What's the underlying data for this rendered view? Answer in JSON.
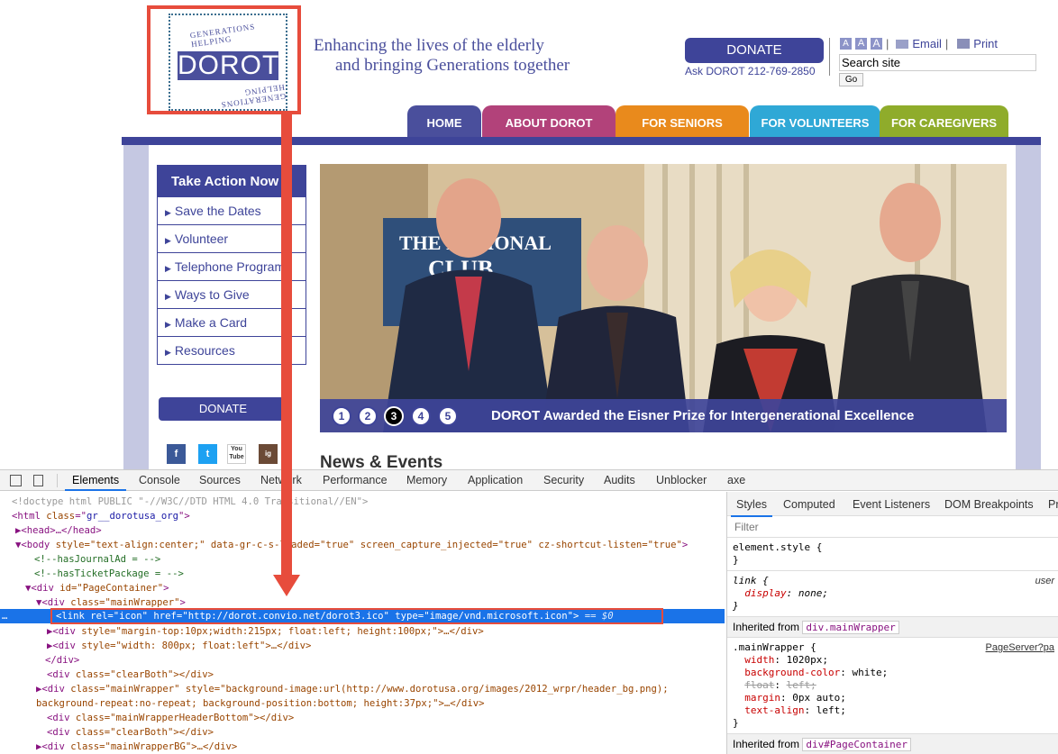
{
  "site": {
    "logo": {
      "arc_top": "GENERATIONS HELPING",
      "word": "DOROT",
      "arc_bottom": "GENERATIONS HELPING"
    },
    "tagline_line1": "Enhancing the lives of the elderly",
    "tagline_line2": "and bringing Generations together",
    "donate_top": "DONATE",
    "ask": "Ask DOROT 212-769-2850",
    "text_size": [
      "A",
      "A",
      "A"
    ],
    "email": "Email",
    "print": "Print",
    "search_value": "Search site",
    "go": "Go",
    "nav": [
      "HOME",
      "ABOUT DOROT",
      "FOR SENIORS",
      "FOR VOLUNTEERS",
      "FOR CAREGIVERS"
    ],
    "nav_colors": [
      "#4a4f9c",
      "#b2427a",
      "#e98a1c",
      "#2fa8d6",
      "#8fac2b"
    ],
    "take_action": "Take Action Now",
    "side_items": [
      "Save the Dates",
      "Volunteer",
      "Telephone Programs",
      "Ways to Give",
      "Make a Card",
      "Resources"
    ],
    "donate_side": "DONATE",
    "social": [
      "f",
      "t",
      "You Tube",
      "ig"
    ],
    "slider_dots": [
      "1",
      "2",
      "3",
      "4",
      "5"
    ],
    "active_dot": "3",
    "hero_caption": "DOROT Awarded the Eisner Prize for Intergenerational Excellence",
    "hero_sign": "THE NATIONAL PRESS CLUB WHERE NEWS HAPPENS",
    "news_heading": "News & Events"
  },
  "devtools": {
    "tabs": [
      "Elements",
      "Console",
      "Sources",
      "Network",
      "Performance",
      "Memory",
      "Application",
      "Security",
      "Audits",
      "Unblocker",
      "axe"
    ],
    "active_tab": "Elements",
    "dom": {
      "doctype": "<!doctype html PUBLIC \"-//W3C//DTD HTML 4.0 Transitional//EN\">",
      "html_tag": "html",
      "html_attr": "class",
      "html_val": "gr__dorotusa_org",
      "head": "<head>…</head>",
      "body_attrs": "style=\"text-align:center;\" data-gr-c-s-loaded=\"true\" screen_capture_injected=\"true\" cz-shortcut-listen=\"true\"",
      "comment1": "<!--hasJournalAd = -->",
      "comment2": "<!--hasTicketPackage = -->",
      "page_container": "id=\"PageContainer\"",
      "main_wrapper": "class=\"mainWrapper\"",
      "selected_link": "<link rel=\"icon\" href=\"http://dorot.convio.net/dorot3.ico\" type=\"image/vnd.microsoft.icon\">",
      "selected_suffix": "== $0",
      "div1": "style=\"margin-top:10px;width:215px; float:left; height:100px;\">…</div>",
      "div2": "style=\"width: 800px; float:left\">…</div>",
      "close_div": "</div>",
      "clear1": "class=\"clearBoth\"></div>",
      "wrapper_bg": "class=\"mainWrapper\" style=\"background-image:url(http://www.dorotusa.org/images/2012_wrpr/header_bg.png);",
      "wrapper_bg2": "background-repeat:no-repeat; background-position:bottom; height:37px;\">…</div>",
      "header_bottom": "class=\"mainWrapperHeaderBottom\"></div>",
      "clear2": "class=\"clearBoth\"></div>",
      "wrapper_bg_div": "class=\"mainWrapperBG\">…</div>",
      "ellipsis": "…"
    },
    "styles": {
      "tabs": [
        "Styles",
        "Computed",
        "Event Listeners",
        "DOM Breakpoints",
        "Pr"
      ],
      "filter_placeholder": "Filter",
      "element_style": "element.style {",
      "close": "}",
      "link_rule": "link {",
      "link_prop": "display",
      "link_val": "none;",
      "link_src": "user",
      "inherited1_label": "Inherited from",
      "inherited1_el": "div.mainWrapper",
      "mw_rule": ".mainWrapper {",
      "mw_src": "PageServer?pa",
      "mw_props": [
        {
          "name": "width",
          "value": "1020px;"
        },
        {
          "name": "background-color",
          "value": "white;"
        },
        {
          "name": "float",
          "value": "left;"
        },
        {
          "name": "margin",
          "value": "0px auto;"
        },
        {
          "name": "text-align",
          "value": "left;"
        }
      ],
      "inherited2_label": "Inherited from",
      "inherited2_el": "div#PageContainer"
    }
  }
}
